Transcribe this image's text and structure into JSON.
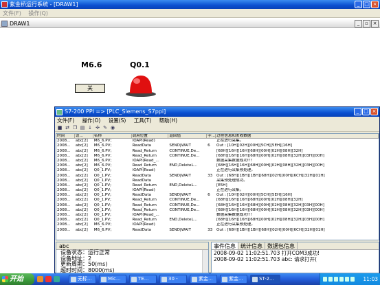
{
  "app": {
    "title": "紫金桥运行系统 - [DRAW1]",
    "menu": [
      "文件(F)",
      "操作(Q)"
    ]
  },
  "draw": {
    "title": "DRAW1",
    "label_m66": "M6.6",
    "label_q01": "Q0.1",
    "off_button": "关",
    "lamp_color": "#e01010"
  },
  "ppi": {
    "title": "S7-200 PPI => [PLC_Siemens_S7ppi]",
    "menu": [
      "文件(F)",
      "操作(O)",
      "设置(S)",
      "工具(T)",
      "帮助(H)"
    ],
    "columns": [
      "时间",
      "设...",
      "名称",
      "调用位置",
      "返回值",
      "字...",
      "过程信息和发收数据"
    ],
    "rows": [
      [
        "2008...",
        "abc[2]",
        "M6_6.PV;",
        "IOAPI(Read)",
        "",
        "",
        "正在进行采集。"
      ],
      [
        "2008...",
        "abc[2]",
        "M6_6.PV;",
        "ReadData",
        "SEND|WAIT",
        "6",
        "Out : [10H][02H][00H][5CH][5EH][16H]"
      ],
      [
        "2008...",
        "abc[2]",
        "M6_6.PV;",
        "Read_Return",
        "CONTINUE,De...",
        "",
        "[68H][16H][16H][68H][00H][02H][08H][32H]"
      ],
      [
        "2008...",
        "abc[2]",
        "M6_6.PV;",
        "Read_Return",
        "CONTINUE,De...",
        "",
        "[68H][16H][16H][68H][00H][02H][08H][32H][03H][00H]"
      ],
      [
        "2008...",
        "abc[2]",
        "M6_6.PV;",
        "IOAPI(Read_...",
        "",
        "",
        "数据采集数据成功!!!"
      ],
      [
        "2008...",
        "abc[2]",
        "M6_6.PV;",
        "Read_Return",
        "END,DeleteL...",
        "",
        "[68H][16H][16H][68H][00H][02H][08H][32H][03H][00H]"
      ],
      [
        "2008...",
        "abc[2]",
        "Q0_1.PV;",
        "IOAPI(Read)",
        "",
        "",
        "正在进行采集预处理。"
      ],
      [
        "2008...",
        "abc[2]",
        "Q0_1.PV;",
        "ReadData",
        "SEND|WAIT",
        "33",
        "Out : [68H][1BH][1BH][68H][02H][00H][6CH][32H][01H]"
      ],
      [
        "2008...",
        "abc[2]",
        "Q0_1.PV;",
        "ReadData",
        "",
        "",
        "采集预处理成功。"
      ],
      [
        "2008...",
        "abc[2]",
        "Q0_1.PV;",
        "Read_Return",
        "END,DeleteL...",
        "",
        "[E5H]"
      ],
      [
        "2008...",
        "abc[2]",
        "Q0_1.PV;",
        "IOAPI(Read)",
        "",
        "",
        "正在进行采集。"
      ],
      [
        "2008...",
        "abc[2]",
        "Q0_1.PV;",
        "ReadData",
        "SEND|WAIT",
        "6",
        "Out : [10H][02H][00H][5CH][5EH][16H]"
      ],
      [
        "2008...",
        "abc[2]",
        "Q0_1.PV;",
        "Read_Return",
        "CONTINUE,De...",
        "",
        "[68H][16H][16H][68H][00H][02H][08H][32H]"
      ],
      [
        "2008...",
        "abc[2]",
        "Q0_1.PV;",
        "Read_Return",
        "CONTINUE,De...",
        "",
        "[68H][16H][16H][68H][00H][02H][08H][32H][03H][00H]"
      ],
      [
        "2008...",
        "abc[2]",
        "Q0_1.PV;",
        "Read_Return",
        "CONTINUE,De...",
        "",
        "[68H][16H][16H][68H][00H][02H][08H][32H][03H][00H]"
      ],
      [
        "2008...",
        "abc[2]",
        "Q0_1.PV;",
        "IOAPI(Read_...",
        "",
        "",
        "数据采集数据成功!!!"
      ],
      [
        "2008...",
        "abc[2]",
        "Q0_1.PV;",
        "Read_Return",
        "END,DeleteL...",
        "",
        "[68H][16H][16H][68H][00H][02H][08H][32H][03H][00H]"
      ],
      [
        "2008...",
        "abc[2]",
        "M6_6.PV;",
        "IOAPI(Read)",
        "",
        "",
        "正在进行采集预处理。"
      ],
      [
        "2008...",
        "abc[2]",
        "M6_6.PV;",
        "ReadData",
        "SEND|WAIT",
        "33",
        "Out : [68H][1BH][1BH][68H][02H][00H][6CH][32H][01H]"
      ]
    ],
    "abc_tab": "abc",
    "abc_lines": [
      "设备状态：运行正常",
      "设备地址：2",
      "更新周期：50(ms)",
      "超时时间：8000(ms)"
    ],
    "event_tabs": [
      "事件信息",
      "统计信息",
      "数据包信息"
    ],
    "events": [
      "2008-09-02 11:02:51.703  打开COM3成功!",
      "2008-09-02 11:02:51.703  abc: 请求打开("
    ]
  },
  "taskbar": {
    "start": "开始",
    "tasks": [
      "无标...",
      "Mic...",
      "TE...",
      "30 -",
      "紫金...",
      "紫金...",
      "ST-2..."
    ],
    "clock": "11:03"
  }
}
